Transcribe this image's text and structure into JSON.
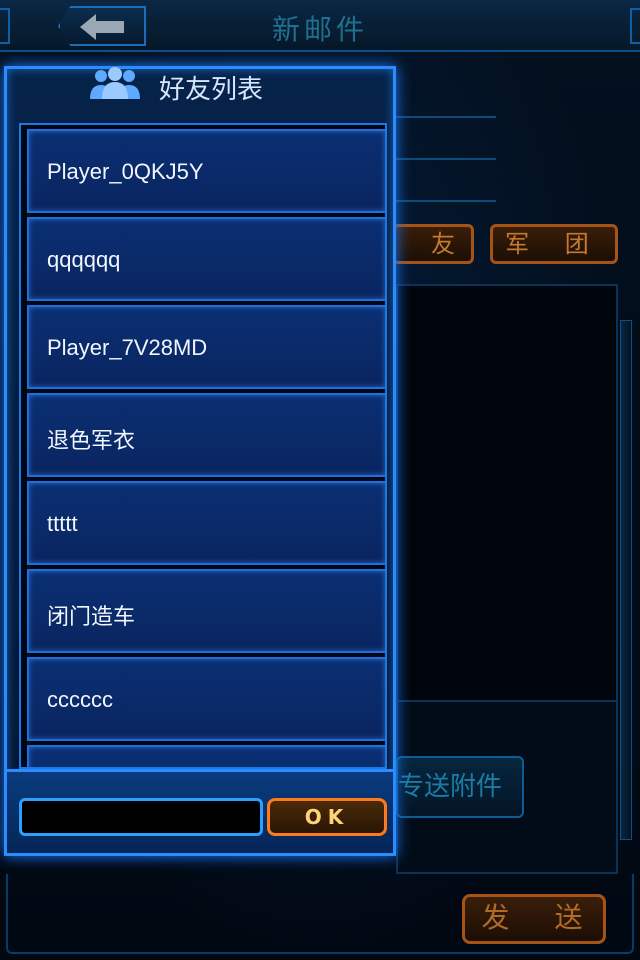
{
  "header": {
    "title": "新邮件",
    "back_icon": "back-arrow-icon"
  },
  "tabs": {
    "friend_label": "友",
    "legion_label": "军 团"
  },
  "buttons": {
    "attach_label": "专送附件",
    "send_label": "发 送"
  },
  "friends_modal": {
    "title": "好友列表",
    "icon": "friends-icon",
    "friends": [
      {
        "name": "Player_0QKJ5Y"
      },
      {
        "name": "qqqqqq"
      },
      {
        "name": "Player_7V28MD"
      },
      {
        "name": "退色军衣"
      },
      {
        "name": "ttttt"
      },
      {
        "name": "闭门造车"
      },
      {
        "name": "cccccc"
      },
      {
        "name": ""
      }
    ],
    "input_value": "",
    "ok_label": "OK"
  },
  "colors": {
    "accent_blue": "#2a8cff",
    "accent_orange": "#ff7b1a",
    "background": "#020b18"
  }
}
